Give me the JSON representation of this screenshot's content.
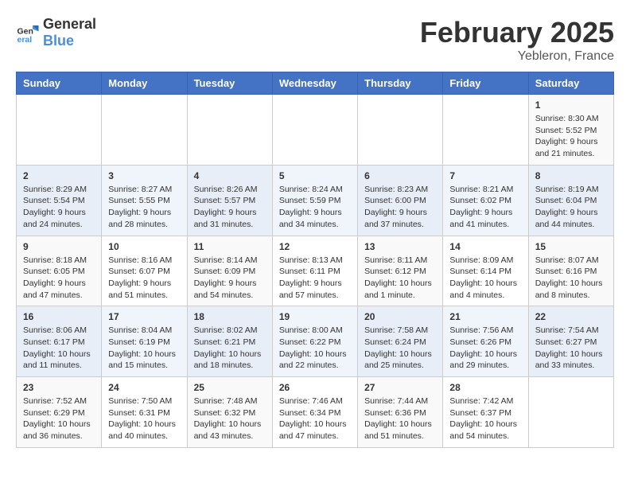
{
  "header": {
    "logo_general": "General",
    "logo_blue": "Blue",
    "title": "February 2025",
    "subtitle": "Yebleron, France"
  },
  "weekdays": [
    "Sunday",
    "Monday",
    "Tuesday",
    "Wednesday",
    "Thursday",
    "Friday",
    "Saturday"
  ],
  "weeks": [
    [
      {
        "day": "",
        "info": ""
      },
      {
        "day": "",
        "info": ""
      },
      {
        "day": "",
        "info": ""
      },
      {
        "day": "",
        "info": ""
      },
      {
        "day": "",
        "info": ""
      },
      {
        "day": "",
        "info": ""
      },
      {
        "day": "1",
        "info": "Sunrise: 8:30 AM\nSunset: 5:52 PM\nDaylight: 9 hours and 21 minutes."
      }
    ],
    [
      {
        "day": "2",
        "info": "Sunrise: 8:29 AM\nSunset: 5:54 PM\nDaylight: 9 hours and 24 minutes."
      },
      {
        "day": "3",
        "info": "Sunrise: 8:27 AM\nSunset: 5:55 PM\nDaylight: 9 hours and 28 minutes."
      },
      {
        "day": "4",
        "info": "Sunrise: 8:26 AM\nSunset: 5:57 PM\nDaylight: 9 hours and 31 minutes."
      },
      {
        "day": "5",
        "info": "Sunrise: 8:24 AM\nSunset: 5:59 PM\nDaylight: 9 hours and 34 minutes."
      },
      {
        "day": "6",
        "info": "Sunrise: 8:23 AM\nSunset: 6:00 PM\nDaylight: 9 hours and 37 minutes."
      },
      {
        "day": "7",
        "info": "Sunrise: 8:21 AM\nSunset: 6:02 PM\nDaylight: 9 hours and 41 minutes."
      },
      {
        "day": "8",
        "info": "Sunrise: 8:19 AM\nSunset: 6:04 PM\nDaylight: 9 hours and 44 minutes."
      }
    ],
    [
      {
        "day": "9",
        "info": "Sunrise: 8:18 AM\nSunset: 6:05 PM\nDaylight: 9 hours and 47 minutes."
      },
      {
        "day": "10",
        "info": "Sunrise: 8:16 AM\nSunset: 6:07 PM\nDaylight: 9 hours and 51 minutes."
      },
      {
        "day": "11",
        "info": "Sunrise: 8:14 AM\nSunset: 6:09 PM\nDaylight: 9 hours and 54 minutes."
      },
      {
        "day": "12",
        "info": "Sunrise: 8:13 AM\nSunset: 6:11 PM\nDaylight: 9 hours and 57 minutes."
      },
      {
        "day": "13",
        "info": "Sunrise: 8:11 AM\nSunset: 6:12 PM\nDaylight: 10 hours and 1 minute."
      },
      {
        "day": "14",
        "info": "Sunrise: 8:09 AM\nSunset: 6:14 PM\nDaylight: 10 hours and 4 minutes."
      },
      {
        "day": "15",
        "info": "Sunrise: 8:07 AM\nSunset: 6:16 PM\nDaylight: 10 hours and 8 minutes."
      }
    ],
    [
      {
        "day": "16",
        "info": "Sunrise: 8:06 AM\nSunset: 6:17 PM\nDaylight: 10 hours and 11 minutes."
      },
      {
        "day": "17",
        "info": "Sunrise: 8:04 AM\nSunset: 6:19 PM\nDaylight: 10 hours and 15 minutes."
      },
      {
        "day": "18",
        "info": "Sunrise: 8:02 AM\nSunset: 6:21 PM\nDaylight: 10 hours and 18 minutes."
      },
      {
        "day": "19",
        "info": "Sunrise: 8:00 AM\nSunset: 6:22 PM\nDaylight: 10 hours and 22 minutes."
      },
      {
        "day": "20",
        "info": "Sunrise: 7:58 AM\nSunset: 6:24 PM\nDaylight: 10 hours and 25 minutes."
      },
      {
        "day": "21",
        "info": "Sunrise: 7:56 AM\nSunset: 6:26 PM\nDaylight: 10 hours and 29 minutes."
      },
      {
        "day": "22",
        "info": "Sunrise: 7:54 AM\nSunset: 6:27 PM\nDaylight: 10 hours and 33 minutes."
      }
    ],
    [
      {
        "day": "23",
        "info": "Sunrise: 7:52 AM\nSunset: 6:29 PM\nDaylight: 10 hours and 36 minutes."
      },
      {
        "day": "24",
        "info": "Sunrise: 7:50 AM\nSunset: 6:31 PM\nDaylight: 10 hours and 40 minutes."
      },
      {
        "day": "25",
        "info": "Sunrise: 7:48 AM\nSunset: 6:32 PM\nDaylight: 10 hours and 43 minutes."
      },
      {
        "day": "26",
        "info": "Sunrise: 7:46 AM\nSunset: 6:34 PM\nDaylight: 10 hours and 47 minutes."
      },
      {
        "day": "27",
        "info": "Sunrise: 7:44 AM\nSunset: 6:36 PM\nDaylight: 10 hours and 51 minutes."
      },
      {
        "day": "28",
        "info": "Sunrise: 7:42 AM\nSunset: 6:37 PM\nDaylight: 10 hours and 54 minutes."
      },
      {
        "day": "",
        "info": ""
      }
    ]
  ]
}
